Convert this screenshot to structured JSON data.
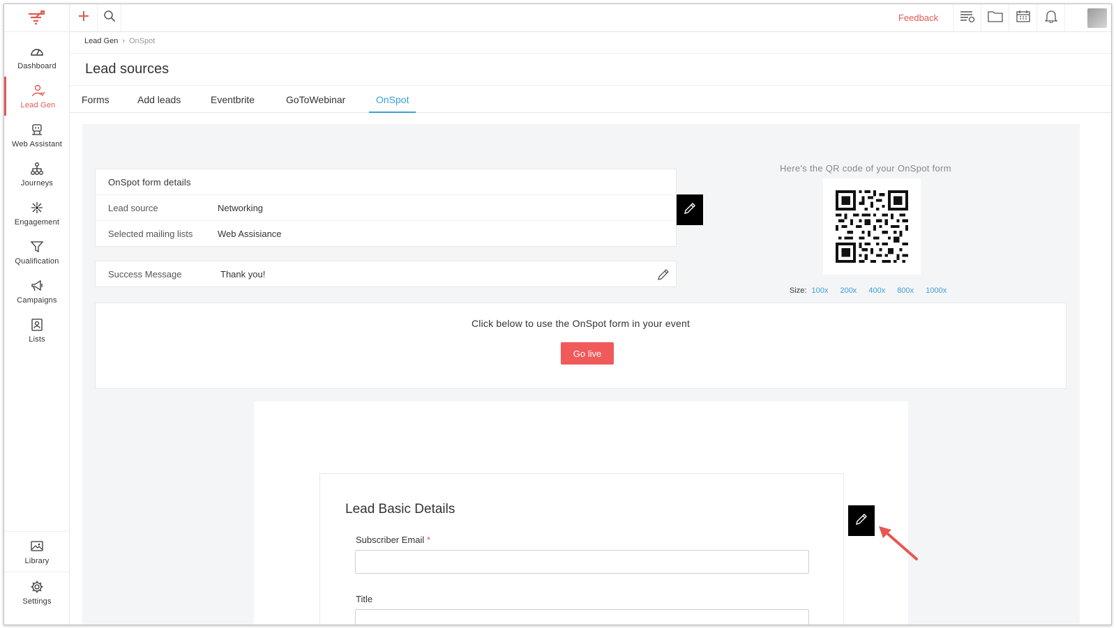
{
  "app": {
    "brand_color": "#e25950",
    "accent_color": "#3a9fd8"
  },
  "sidebar": {
    "items": [
      {
        "label": "Dashboard",
        "icon": "gauge-icon"
      },
      {
        "label": "Lead Gen",
        "icon": "lead-gen-icon",
        "active": true
      },
      {
        "label": "Web Assistant",
        "icon": "web-assistant-icon"
      },
      {
        "label": "Journeys",
        "icon": "journeys-icon"
      },
      {
        "label": "Engagement",
        "icon": "engagement-icon"
      },
      {
        "label": "Qualification",
        "icon": "funnel-icon"
      },
      {
        "label": "Campaigns",
        "icon": "megaphone-icon"
      },
      {
        "label": "Lists",
        "icon": "contact-list-icon"
      }
    ],
    "bottom_items": [
      {
        "label": "Library",
        "icon": "image-icon"
      },
      {
        "label": "Settings",
        "icon": "gear-icon"
      }
    ]
  },
  "topbar": {
    "feedback_label": "Feedback",
    "icons": [
      "plus-icon",
      "search-icon",
      "list-icon",
      "folder-icon",
      "calendar-icon",
      "bell-icon",
      "avatar"
    ]
  },
  "breadcrumb": {
    "parent": "Lead Gen",
    "current": "OnSpot"
  },
  "page_title": "Lead sources",
  "tabs": [
    {
      "label": "Forms"
    },
    {
      "label": "Add leads"
    },
    {
      "label": "Eventbrite"
    },
    {
      "label": "GoToWebinar"
    },
    {
      "label": "OnSpot",
      "active": true
    }
  ],
  "details": {
    "header": "OnSpot form details",
    "lead_source_label": "Lead source",
    "lead_source_value": "Networking",
    "mailing_lists_label": "Selected mailing lists",
    "mailing_lists_value": "Web Assisiance"
  },
  "success": {
    "label": "Success Message",
    "value": "Thank you!"
  },
  "qr": {
    "caption": "Here's the QR code of your OnSpot form",
    "size_label": "Size:",
    "sizes": [
      "100x",
      "200x",
      "400x",
      "800x",
      "1000x"
    ]
  },
  "golive": {
    "text": "Click below to use the OnSpot form in your event",
    "button": "Go live"
  },
  "form_preview": {
    "title": "Lead Basic Details",
    "fields": [
      {
        "label": "Subscriber Email",
        "required": "*",
        "value": ""
      },
      {
        "label": "Title",
        "value": ""
      }
    ]
  }
}
